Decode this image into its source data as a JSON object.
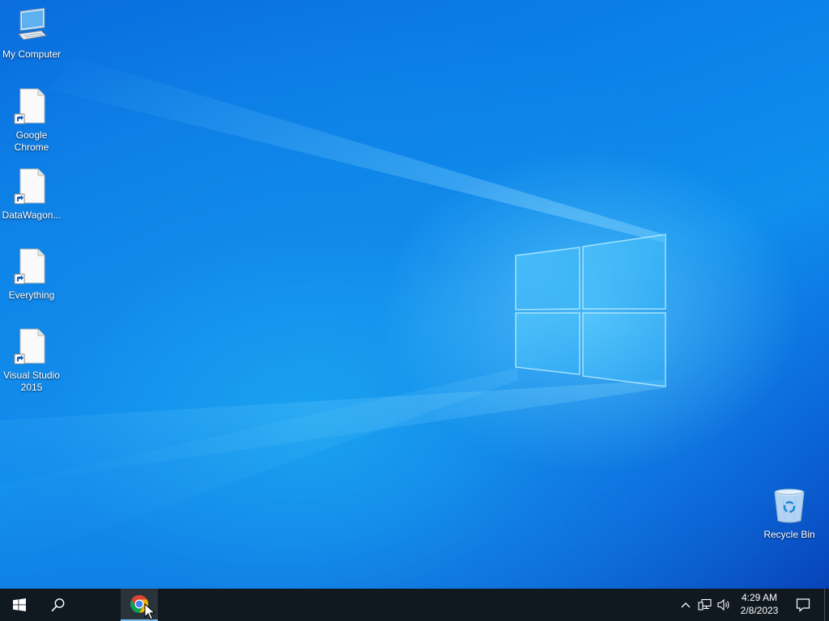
{
  "desktop": {
    "icons": [
      {
        "label": "My Computer",
        "icon": "monitor-icon"
      },
      {
        "label": "Google Chrome",
        "icon": "blank-file-shortcut-icon"
      },
      {
        "label": "DataWagon...",
        "icon": "blank-file-shortcut-icon"
      },
      {
        "label": "Everything",
        "icon": "blank-file-shortcut-icon"
      },
      {
        "label": "Visual Studio 2015",
        "icon": "blank-file-shortcut-icon"
      },
      {
        "label": "Recycle Bin",
        "icon": "recycle-bin-icon"
      }
    ]
  },
  "taskbar": {
    "start_icon": "windows-logo-icon",
    "search_icon": "search-icon",
    "pinned": [
      {
        "name": "chrome",
        "icon": "chrome-icon"
      }
    ],
    "tray": {
      "overflow_icon": "chevron-up-icon",
      "network_icon": "network-icon",
      "volume_icon": "speaker-icon"
    },
    "clock": {
      "time": "4:29 AM",
      "date": "2/8/2023"
    },
    "notification_icon": "action-center-icon"
  },
  "colors": {
    "taskbar_bg": "#101820",
    "desktop_blue": "#0a6ede",
    "active_indicator": "#76b9ed"
  }
}
